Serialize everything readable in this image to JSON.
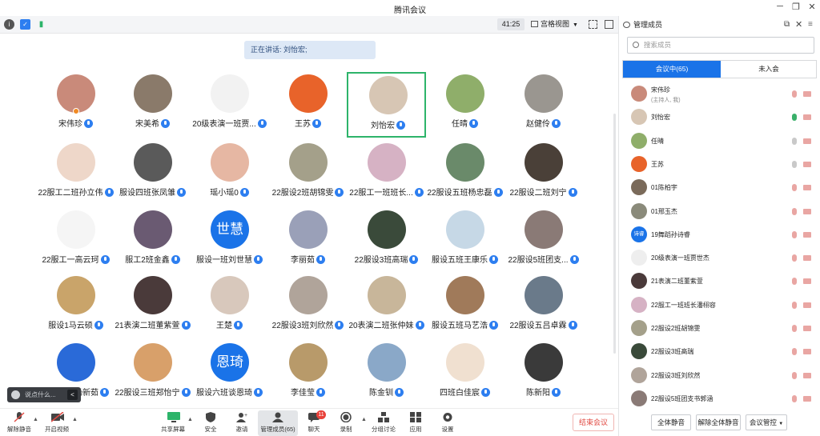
{
  "window": {
    "title": "腾讯会议"
  },
  "toolbar": {
    "timer": "41:25",
    "view_label": "宫格视图"
  },
  "speaker": {
    "text": "正在讲话: 刘怡宏;"
  },
  "colors": {
    "accent": "#1a73e8",
    "active_speaker_border": "#2db46a",
    "end_button": "#e14b44"
  },
  "participants": [
    {
      "name": "宋伟珍",
      "avatar_bg": "#c98a7a",
      "host": true
    },
    {
      "name": "宋美希",
      "avatar_bg": "#8a7a6a"
    },
    {
      "name": "20级表演一班贾...",
      "avatar_bg": "#f2f2f2"
    },
    {
      "name": "王苏",
      "avatar_bg": "#e8632a"
    },
    {
      "name": "刘怡宏",
      "avatar_bg": "#d7c6b4",
      "active": true
    },
    {
      "name": "任晴",
      "avatar_bg": "#8fae6a"
    },
    {
      "name": "赵健伶",
      "avatar_bg": "#9a9690"
    },
    {
      "name": "22服工二班孙立伟",
      "avatar_bg": "#eed7c9"
    },
    {
      "name": "服设四班张凤雏",
      "avatar_bg": "#5a5a5a"
    },
    {
      "name": "瑶小瑶0",
      "avatar_bg": "#e6b7a3"
    },
    {
      "name": "22服设2班胡锦雯",
      "avatar_bg": "#a4a08a"
    },
    {
      "name": "22服工一班班长...",
      "avatar_bg": "#d6b2c4"
    },
    {
      "name": "22服设五班杨忠磊",
      "avatar_bg": "#6a8a6a"
    },
    {
      "name": "22服设二班刘宁",
      "avatar_bg": "#4a4038"
    },
    {
      "name": "22服工一高云珂",
      "avatar_bg": "#f5f5f5"
    },
    {
      "name": "服工2班金鑫",
      "avatar_bg": "#6a5a72"
    },
    {
      "name": "服设一班刘世慧",
      "avatar_bg": "#1a73e8",
      "avatar_text": "世慧"
    },
    {
      "name": "李丽茹",
      "avatar_bg": "#9aa0b8"
    },
    {
      "name": "22服设3班高瑞",
      "avatar_bg": "#3a4a3a"
    },
    {
      "name": "服设五班王康乐",
      "avatar_bg": "#c6d8e6"
    },
    {
      "name": "22服设5班团支...",
      "avatar_bg": "#8a7a76"
    },
    {
      "name": "服设1马云硕",
      "avatar_bg": "#c9a46a"
    },
    {
      "name": "21表演二班董紫萱",
      "avatar_bg": "#4a3a3a"
    },
    {
      "name": "王楚",
      "avatar_bg": "#d8c8bc"
    },
    {
      "name": "22服设3班刘欣然",
      "avatar_bg": "#b0a49a"
    },
    {
      "name": "20表演二班张仲妹",
      "avatar_bg": "#c8b69a"
    },
    {
      "name": "服设五班马艺浩",
      "avatar_bg": "#a07a5a"
    },
    {
      "name": "22服设五吕卓霖",
      "avatar_bg": "#6a7a8a"
    },
    {
      "name": "服设一班杨新茹",
      "avatar_bg": "#2a6ad8"
    },
    {
      "name": "22服设三班郑怡宁",
      "avatar_bg": "#d8a06a"
    },
    {
      "name": "服设六班谈恩琦",
      "avatar_bg": "#1a73e8",
      "avatar_text": "恩琦"
    },
    {
      "name": "李佳莹",
      "avatar_bg": "#b89a6a"
    },
    {
      "name": "陈金钏",
      "avatar_bg": "#8aa8c8"
    },
    {
      "name": "四班白佳宸",
      "avatar_bg": "#f0e0d0"
    },
    {
      "name": "陈新阳",
      "avatar_bg": "#3a3a3a"
    }
  ],
  "chat": {
    "placeholder": "说点什么..."
  },
  "bottombar": {
    "unmute": "解除静音",
    "start_video": "开启视频",
    "share_screen": "共享屏幕",
    "security": "安全",
    "invite": "邀请",
    "manage_members": "管理成员(65)",
    "chat": "聊天",
    "chat_badge": "11",
    "record": "录制",
    "breakout": "分组讨论",
    "apps": "应用",
    "settings": "设置",
    "end_meeting": "结束会议"
  },
  "panel": {
    "title": "管理成员",
    "search_placeholder": "搜索成员",
    "tab_in_meeting": "会议中(65)",
    "tab_not_joined": "未入会",
    "members": [
      {
        "name": "宋伟珍",
        "sub": "(主持人, 我)",
        "avatar_bg": "#c98a7a",
        "mic": "muted"
      },
      {
        "name": "刘怡宏",
        "avatar_bg": "#d7c6b4",
        "mic": "on"
      },
      {
        "name": "任晴",
        "avatar_bg": "#8fae6a",
        "mic": "grey"
      },
      {
        "name": "王苏",
        "avatar_bg": "#e8632a",
        "mic": "grey"
      },
      {
        "name": "01陈柏宇",
        "avatar_bg": "#7a6a5a",
        "mic": "muted"
      },
      {
        "name": "01邢玉杰",
        "avatar_bg": "#8a8a7a",
        "mic": "muted"
      },
      {
        "name": "19舞蹈孙诗睿",
        "avatar_bg": "#1a73e8",
        "avatar_text": "诗睿",
        "mic": "muted"
      },
      {
        "name": "20级表演一班贾世杰",
        "avatar_bg": "#eeeeee",
        "mic": "muted"
      },
      {
        "name": "21表演二班董紫萱",
        "avatar_bg": "#4a3a3a",
        "mic": "muted"
      },
      {
        "name": "22服工一班班长潘栩容",
        "avatar_bg": "#d6b2c4",
        "mic": "muted"
      },
      {
        "name": "22服设2班胡锦雯",
        "avatar_bg": "#a4a08a",
        "mic": "muted"
      },
      {
        "name": "22服设3班高瑞",
        "avatar_bg": "#3a4a3a",
        "mic": "muted"
      },
      {
        "name": "22服设3班刘欣然",
        "avatar_bg": "#b0a49a",
        "mic": "muted"
      },
      {
        "name": "22服设5班团支书郭涵",
        "avatar_bg": "#8a7a76",
        "mic": "muted"
      }
    ],
    "mute_all": "全体静音",
    "unmute_all": "解除全体静音",
    "meeting_control": "会议管控"
  }
}
